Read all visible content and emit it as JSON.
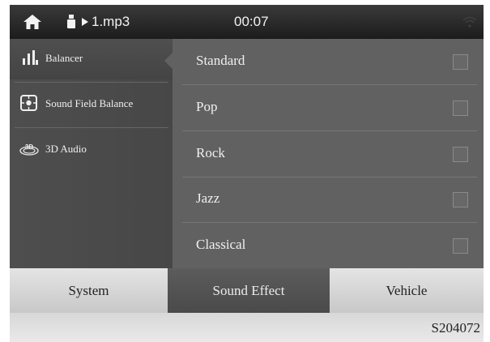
{
  "status_bar": {
    "source_icon": "usb-icon",
    "play_icon": "play-icon",
    "track": "1.mp3",
    "time": "00:07"
  },
  "sidebar": {
    "items": [
      {
        "label": "Balancer",
        "icon": "equalizer-bars-icon",
        "selected": true
      },
      {
        "label": "Sound Field Balance",
        "icon": "sound-field-icon",
        "selected": false
      },
      {
        "label": "3D Audio",
        "icon": "3d-audio-icon",
        "icon_text": "3D",
        "selected": false
      }
    ]
  },
  "presets": {
    "items": [
      {
        "label": "Standard",
        "checked": false
      },
      {
        "label": "Pop",
        "checked": false
      },
      {
        "label": "Rock",
        "checked": false
      },
      {
        "label": "Jazz",
        "checked": false
      },
      {
        "label": "Classical",
        "checked": false
      }
    ]
  },
  "tabs": {
    "items": [
      {
        "label": "System",
        "active": false
      },
      {
        "label": "Sound Effect",
        "active": true
      },
      {
        "label": "Vehicle",
        "active": false
      }
    ]
  },
  "figure_code": "S204072",
  "colors": {
    "status_bar": "#1c1c1c",
    "sidebar": "#4e4e4e",
    "list_panel": "#616161",
    "active_tab": "#4a4a4a",
    "inactive_tab": "#d6d6d6"
  }
}
